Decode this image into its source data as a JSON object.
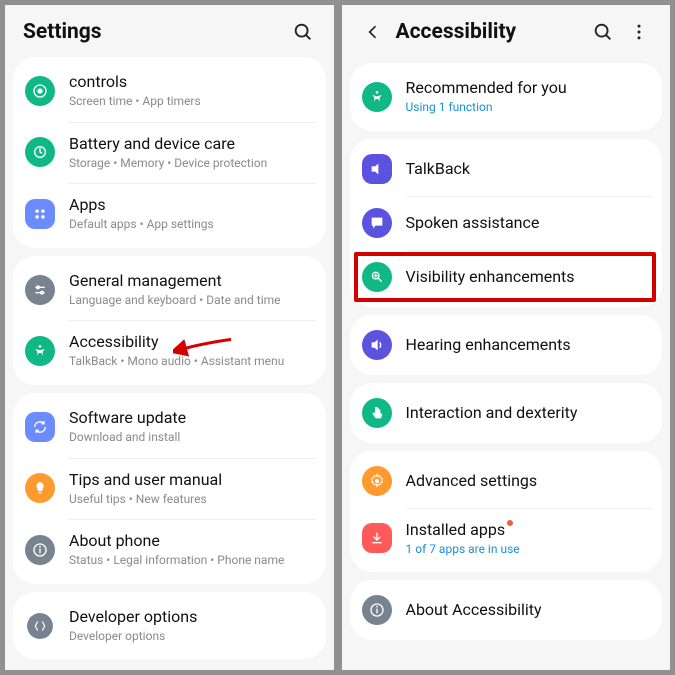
{
  "left": {
    "title": "Settings",
    "items": [
      {
        "title": "controls",
        "sub": "Screen time  •  App timers"
      },
      {
        "title": "Battery and device care",
        "sub": "Storage  •  Memory  •  Device protection"
      },
      {
        "title": "Apps",
        "sub": "Default apps  •  App settings"
      },
      {
        "title": "General management",
        "sub": "Language and keyboard  •  Date and time"
      },
      {
        "title": "Accessibility",
        "sub": "TalkBack  •  Mono audio  •  Assistant menu"
      },
      {
        "title": "Software update",
        "sub": "Download and install"
      },
      {
        "title": "Tips and user manual",
        "sub": "Useful tips  •  New features"
      },
      {
        "title": "About phone",
        "sub": "Status  •  Legal information  •  Phone name"
      },
      {
        "title": "Developer options",
        "sub": "Developer options"
      }
    ]
  },
  "right": {
    "title": "Accessibility",
    "items": [
      {
        "title": "Recommended for you",
        "sub": "Using 1 function"
      },
      {
        "title": "TalkBack"
      },
      {
        "title": "Spoken assistance"
      },
      {
        "title": "Visibility enhancements"
      },
      {
        "title": "Hearing enhancements"
      },
      {
        "title": "Interaction and dexterity"
      },
      {
        "title": "Advanced settings"
      },
      {
        "title": "Installed apps",
        "sub": "1 of 7 apps are in use"
      },
      {
        "title": "About Accessibility"
      }
    ]
  }
}
